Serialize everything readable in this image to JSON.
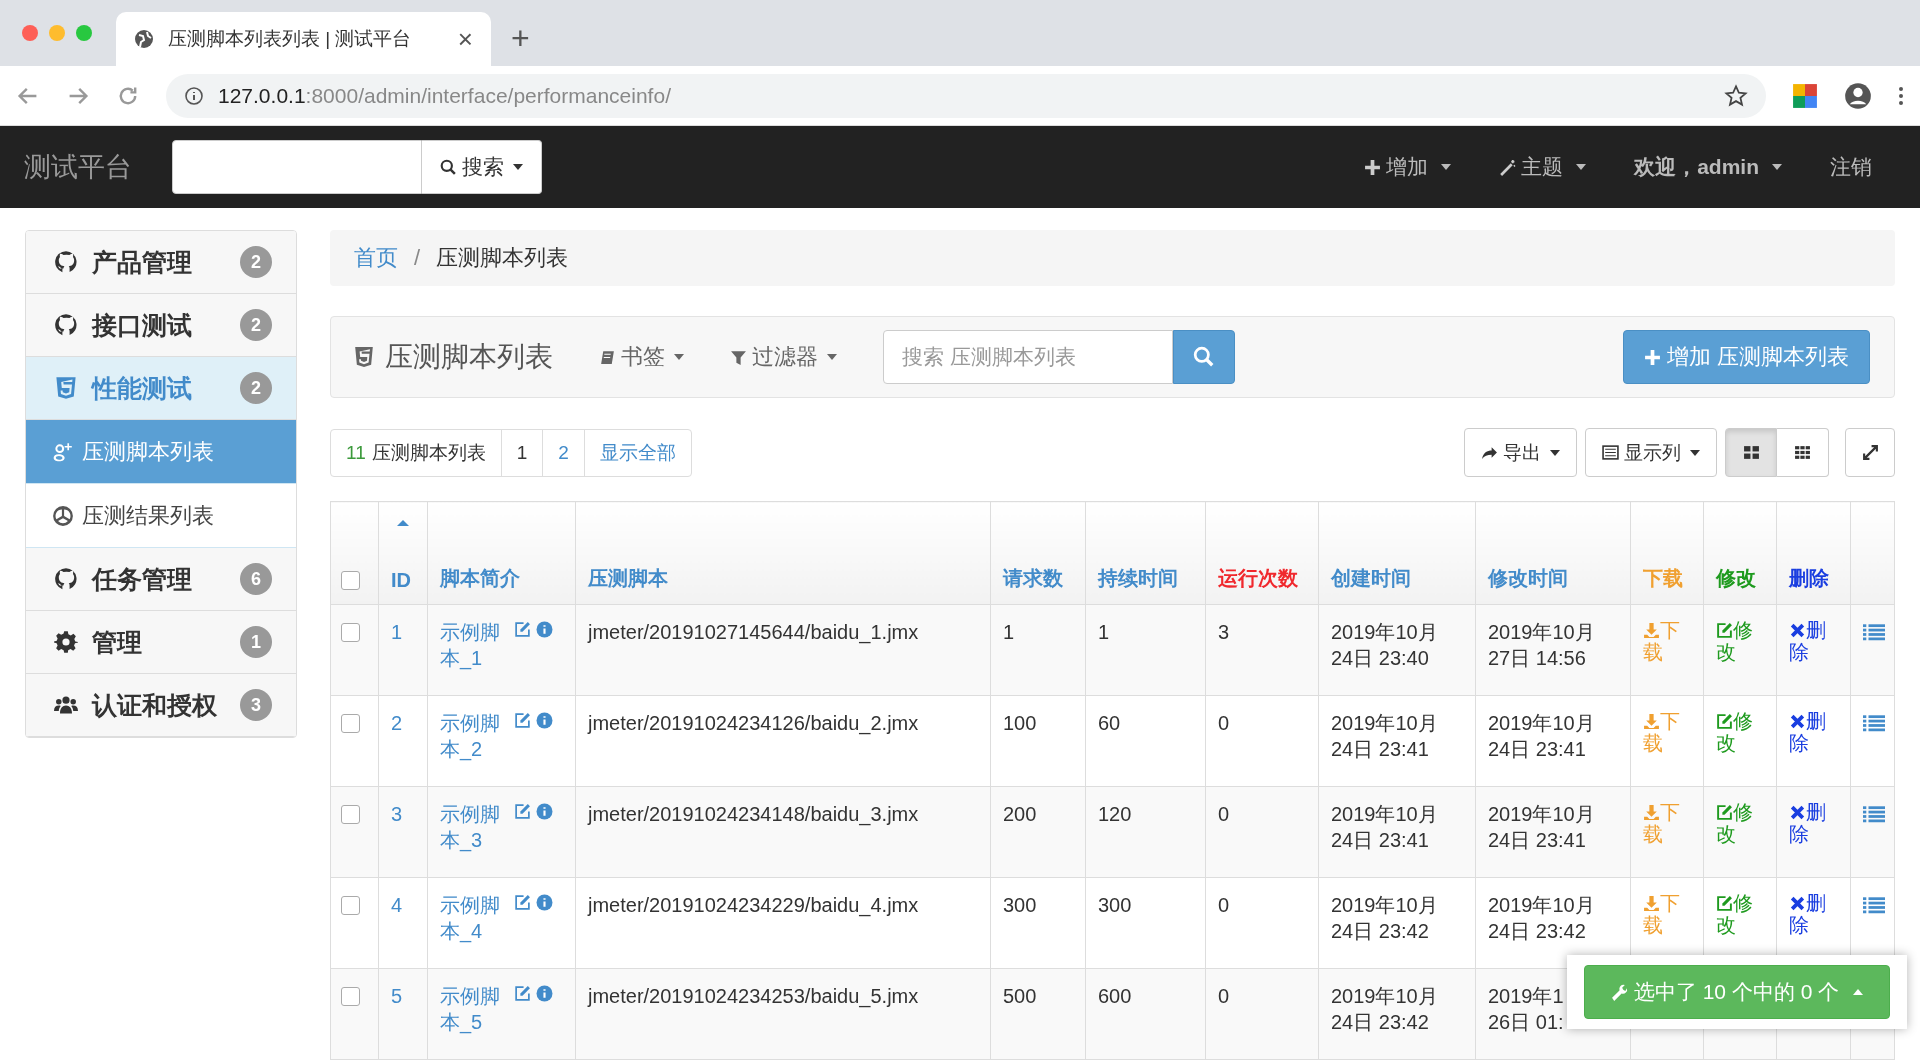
{
  "browser": {
    "tab_title": "压测脚本列表列表 | 测试平台",
    "new_tab": "+",
    "close_tab": "×",
    "url_host": "127.0.0.1",
    "url_path": ":8000/admin/interface/performanceinfo/"
  },
  "navbar": {
    "brand": "测试平台",
    "search_button": "搜索",
    "menus": [
      {
        "label": "增加",
        "kind": "plus"
      },
      {
        "label": "主题",
        "kind": "wand"
      },
      {
        "label": "欢迎，admin",
        "kind": "user"
      }
    ],
    "logout": "注销"
  },
  "sidebar": {
    "items": [
      {
        "label": "产品管理",
        "badge": "2",
        "selected": false
      },
      {
        "label": "接口测试",
        "badge": "2",
        "selected": false
      },
      {
        "label": "性能测试",
        "badge": "2",
        "selected": true,
        "children": [
          {
            "label": "压测脚本列表",
            "selected": true
          },
          {
            "label": "压测结果列表",
            "selected": false
          }
        ]
      },
      {
        "label": "任务管理",
        "badge": "6",
        "selected": false
      },
      {
        "label": "管理",
        "badge": "1",
        "selected": false
      },
      {
        "label": "认证和授权",
        "badge": "3",
        "selected": false
      }
    ]
  },
  "breadcrumb": {
    "items": [
      "首页",
      "压测脚本列表"
    ],
    "separator": "/"
  },
  "toolbar": {
    "title": "压测脚本列表",
    "bookmarks": "书签",
    "filters": "过滤器",
    "search_placeholder": "搜索 压测脚本列表",
    "add_button": "增加 压测脚本列表"
  },
  "pagination": {
    "count": "11",
    "label": "压测脚本列表",
    "pages": [
      {
        "label": "1",
        "selected": true
      },
      {
        "label": "2",
        "selected": false
      }
    ],
    "show_all": "显示全部"
  },
  "actions": {
    "export": "导出",
    "columns": "显示列",
    "layouts": [
      {
        "kind": "large",
        "selected": true
      },
      {
        "kind": "small",
        "selected": false
      }
    ]
  },
  "table": {
    "select_all": false,
    "columns": [
      {
        "label": "ID",
        "color": "#428bca",
        "sorted": true
      },
      {
        "label": "脚本简介",
        "color": "#428bca",
        "sorted": false
      },
      {
        "label": "压测脚本",
        "color": "#428bca",
        "sorted": false
      },
      {
        "label": "请求数",
        "color": "#428bca",
        "sorted": false
      },
      {
        "label": "持续时间",
        "color": "#428bca",
        "sorted": false
      },
      {
        "label": "运行次数",
        "color": "#f0282d",
        "sorted": false
      },
      {
        "label": "创建时间",
        "color": "#428bca",
        "sorted": false
      },
      {
        "label": "修改时间",
        "color": "#428bca",
        "sorted": false
      },
      {
        "label": "下载",
        "color": "#f0a030",
        "sorted": false
      },
      {
        "label": "修改",
        "color": "#1e9a1e",
        "sorted": false
      },
      {
        "label": "删除",
        "color": "#1a3ee0",
        "sorted": false
      }
    ],
    "rows": [
      {
        "checked": false,
        "id": "1",
        "name": "示例脚本_1",
        "script": "jmeter/20191027145644/baidu_1.jmx",
        "requests": "1",
        "duration": "1",
        "runs": "3",
        "created": [
          "2019年10月",
          "24日 23:40"
        ],
        "modified": [
          "2019年10月",
          "27日 14:56"
        ],
        "download": "下载",
        "edit": "修改",
        "delete": "删除"
      },
      {
        "checked": false,
        "id": "2",
        "name": "示例脚本_2",
        "script": "jmeter/20191024234126/baidu_2.jmx",
        "requests": "100",
        "duration": "60",
        "runs": "0",
        "created": [
          "2019年10月",
          "24日 23:41"
        ],
        "modified": [
          "2019年10月",
          "24日 23:41"
        ],
        "download": "下载",
        "edit": "修改",
        "delete": "删除"
      },
      {
        "checked": false,
        "id": "3",
        "name": "示例脚本_3",
        "script": "jmeter/20191024234148/baidu_3.jmx",
        "requests": "200",
        "duration": "120",
        "runs": "0",
        "created": [
          "2019年10月",
          "24日 23:41"
        ],
        "modified": [
          "2019年10月",
          "24日 23:41"
        ],
        "download": "下载",
        "edit": "修改",
        "delete": "删除"
      },
      {
        "checked": false,
        "id": "4",
        "name": "示例脚本_4",
        "script": "jmeter/20191024234229/baidu_4.jmx",
        "requests": "300",
        "duration": "300",
        "runs": "0",
        "created": [
          "2019年10月",
          "24日 23:42"
        ],
        "modified": [
          "2019年10月",
          "24日 23:42"
        ],
        "download": "下载",
        "edit": "修改",
        "delete": "删除"
      },
      {
        "checked": false,
        "id": "5",
        "name": "示例脚本_5",
        "script": "jmeter/20191024234253/baidu_5.jmx",
        "requests": "500",
        "duration": "600",
        "runs": "0",
        "created": [
          "2019年10月",
          "24日 23:42"
        ],
        "modified": [
          "2019年1",
          "26日 01:"
        ]
      }
    ]
  },
  "selection_button": "选中了 10 个中的 0 个"
}
